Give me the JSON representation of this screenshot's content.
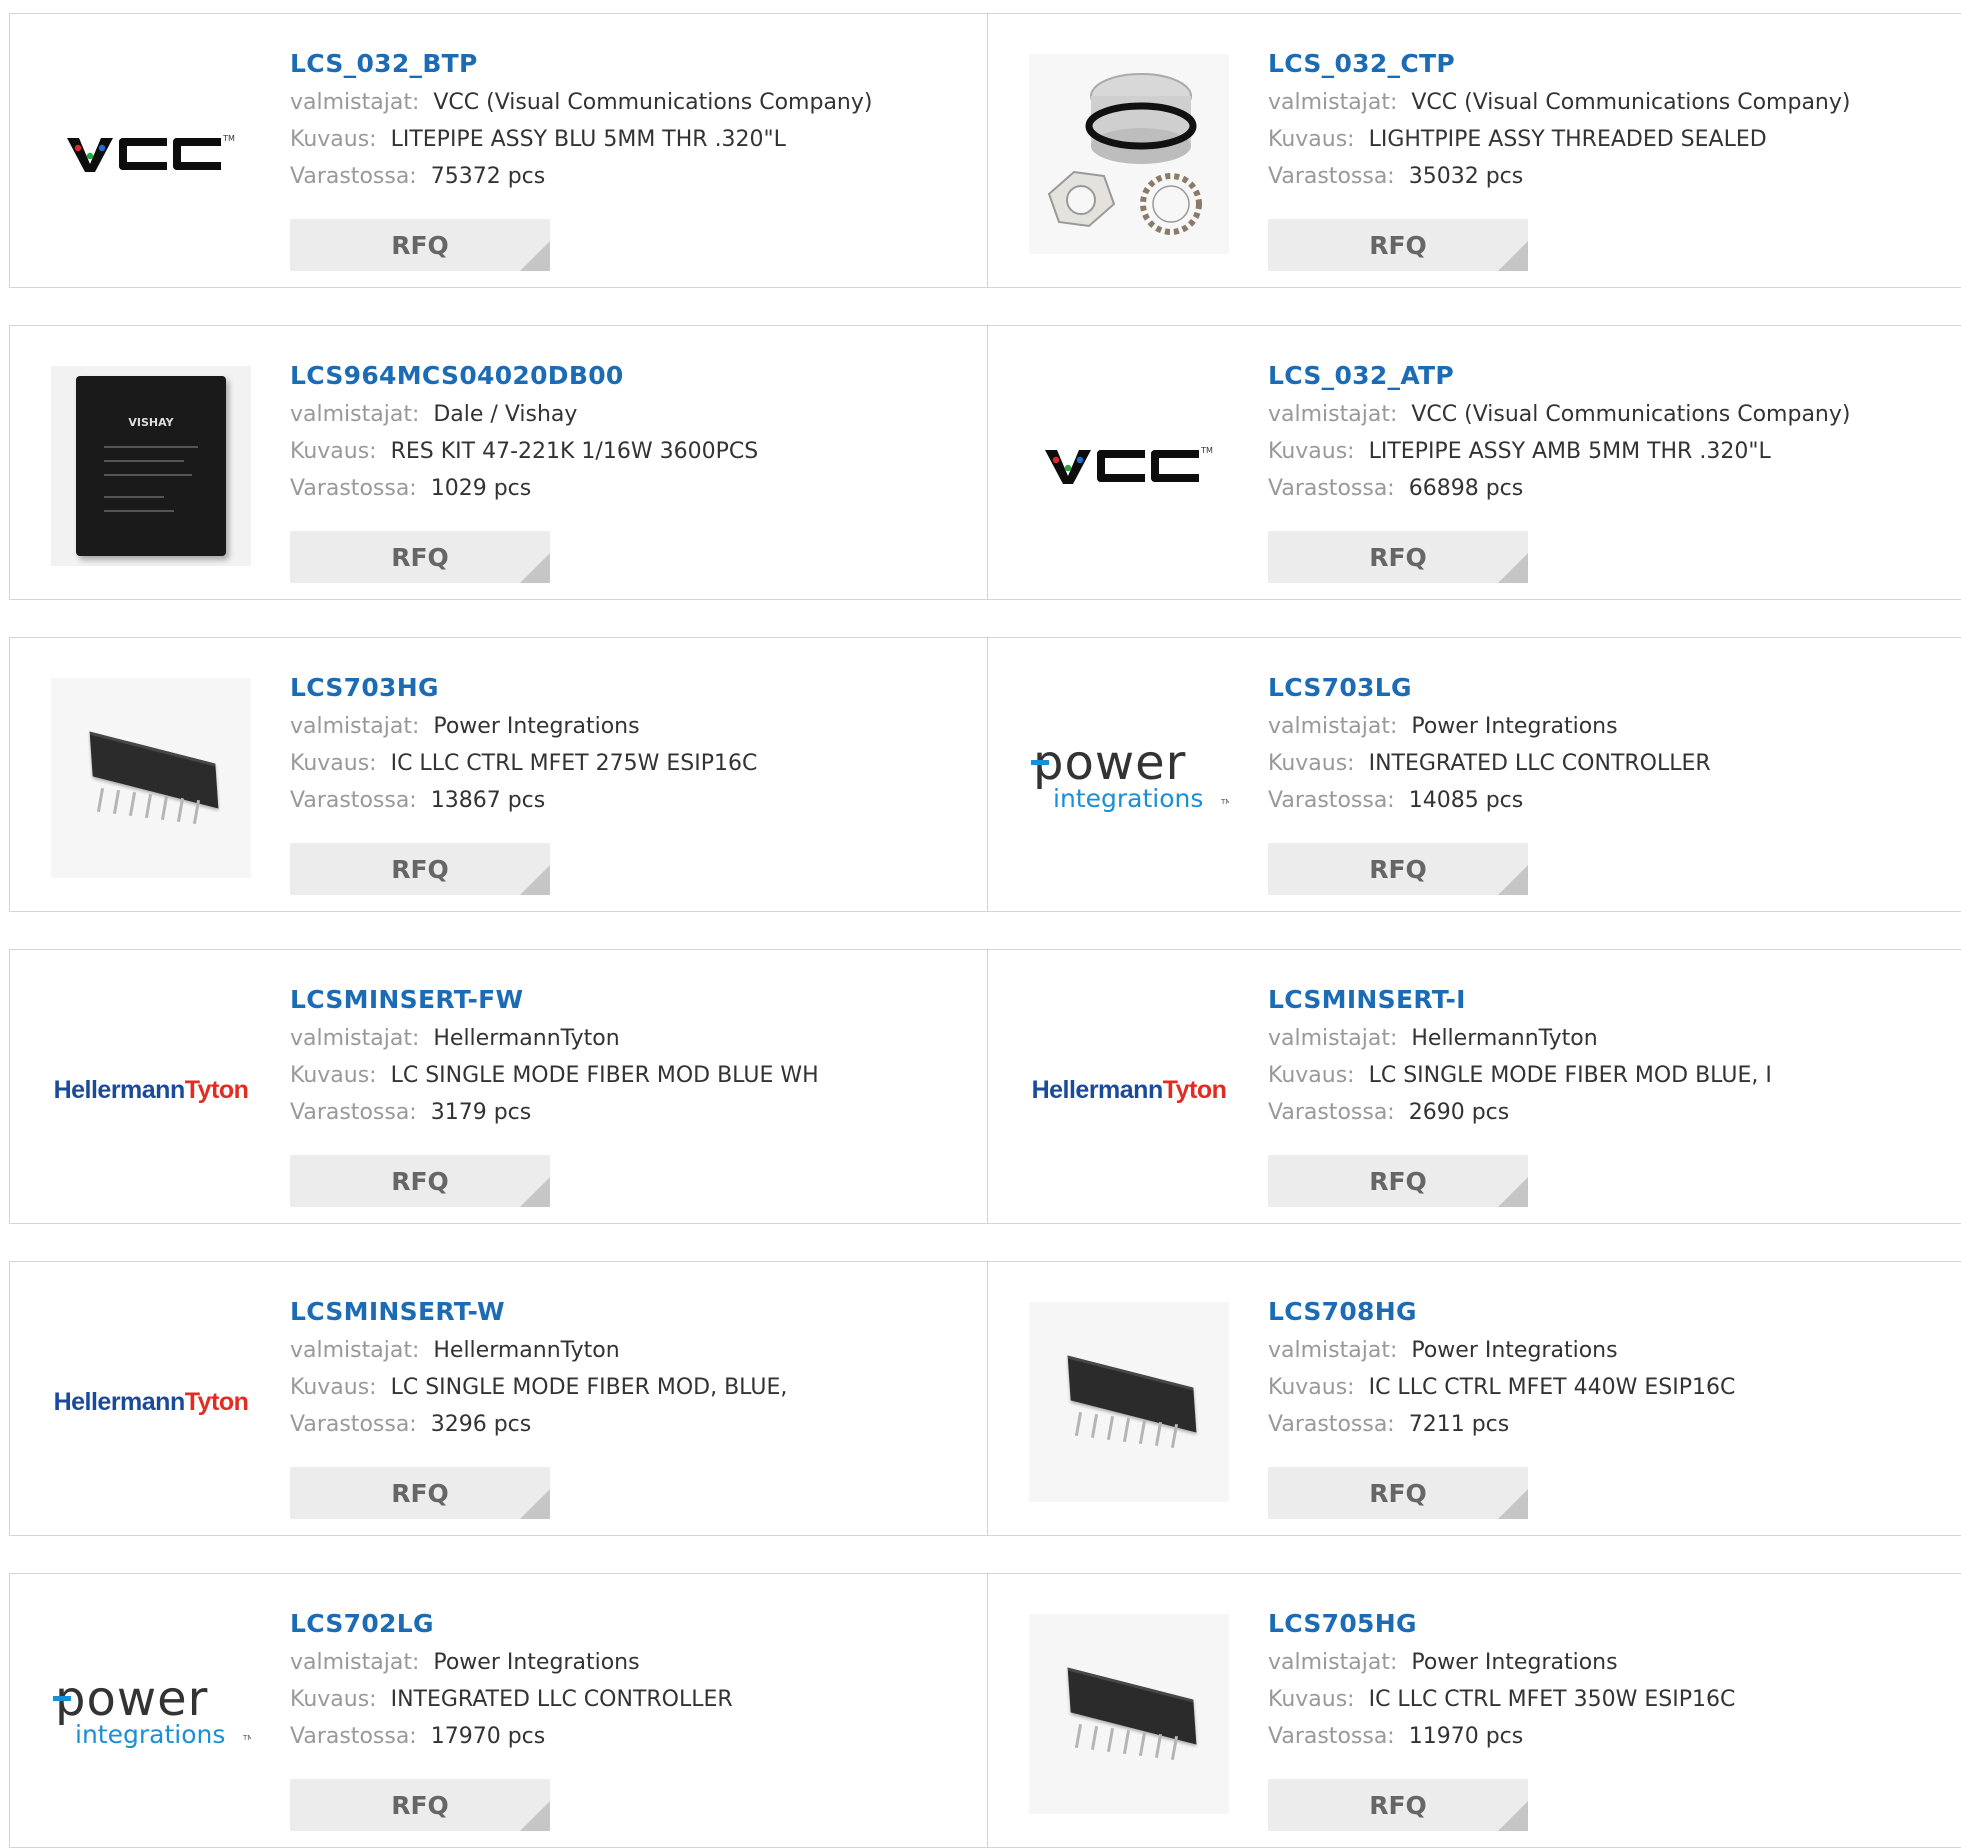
{
  "labels": {
    "manufacturer": "valmistajat:",
    "description": "Kuvaus:",
    "stock": "Varastossa:"
  },
  "colors": {
    "link": "#1c6bb5",
    "label": "#999999",
    "button_bg": "#ececec"
  },
  "products": [
    {
      "pn": "LCS_032_BTP",
      "manufacturer": "VCC (Visual Communications Company)",
      "description": "LITEPIPE ASSY BLU 5MM THR .320\"L",
      "stock": "75372 pcs",
      "rfq": "RFQ",
      "image": "vcc-logo"
    },
    {
      "pn": "LCS_032_CTP",
      "manufacturer": "VCC (Visual Communications Company)",
      "description": "LIGHTPIPE ASSY THREADED SEALED",
      "stock": "35032 pcs",
      "rfq": "RFQ",
      "image": "lightpipe-photo"
    },
    {
      "pn": "LCS964MCS04020DB00",
      "manufacturer": "Dale / Vishay",
      "description": "RES KIT 47-221K 1/16W 3600PCS",
      "stock": "1029 pcs",
      "rfq": "RFQ",
      "image": "vishay-kit-photo",
      "image_text": "VISHAY"
    },
    {
      "pn": "LCS_032_ATP",
      "manufacturer": "VCC (Visual Communications Company)",
      "description": "LITEPIPE ASSY AMB 5MM THR .320\"L",
      "stock": "66898 pcs",
      "rfq": "RFQ",
      "image": "vcc-logo"
    },
    {
      "pn": "LCS703HG",
      "manufacturer": "Power Integrations",
      "description": "IC LLC CTRL MFET 275W ESIP16C",
      "stock": "13867 pcs",
      "rfq": "RFQ",
      "image": "chip-photo"
    },
    {
      "pn": "LCS703LG",
      "manufacturer": "Power Integrations",
      "description": "INTEGRATED LLC CONTROLLER",
      "stock": "14085 pcs",
      "rfq": "RFQ",
      "image": "power-integrations-logo"
    },
    {
      "pn": "LCSMINSERT-FW",
      "manufacturer": "HellermannTyton",
      "description": "LC SINGLE MODE FIBER MOD BLUE WH",
      "stock": "3179 pcs",
      "rfq": "RFQ",
      "image": "hellermanntyton-logo"
    },
    {
      "pn": "LCSMINSERT-I",
      "manufacturer": "HellermannTyton",
      "description": "LC SINGLE MODE FIBER MOD BLUE, I",
      "stock": "2690 pcs",
      "rfq": "RFQ",
      "image": "hellermanntyton-logo"
    },
    {
      "pn": "LCSMINSERT-W",
      "manufacturer": "HellermannTyton",
      "description": "LC SINGLE MODE FIBER MOD, BLUE,",
      "stock": "3296 pcs",
      "rfq": "RFQ",
      "image": "hellermanntyton-logo"
    },
    {
      "pn": "LCS708HG",
      "manufacturer": "Power Integrations",
      "description": "IC LLC CTRL MFET 440W ESIP16C",
      "stock": "7211 pcs",
      "rfq": "RFQ",
      "image": "chip-photo"
    },
    {
      "pn": "LCS702LG",
      "manufacturer": "Power Integrations",
      "description": "INTEGRATED LLC CONTROLLER",
      "stock": "17970 pcs",
      "rfq": "RFQ",
      "image": "power-integrations-logo"
    },
    {
      "pn": "LCS705HG",
      "manufacturer": "Power Integrations",
      "description": "IC LLC CTRL MFET 350W ESIP16C",
      "stock": "11970 pcs",
      "rfq": "RFQ",
      "image": "chip-photo"
    }
  ]
}
